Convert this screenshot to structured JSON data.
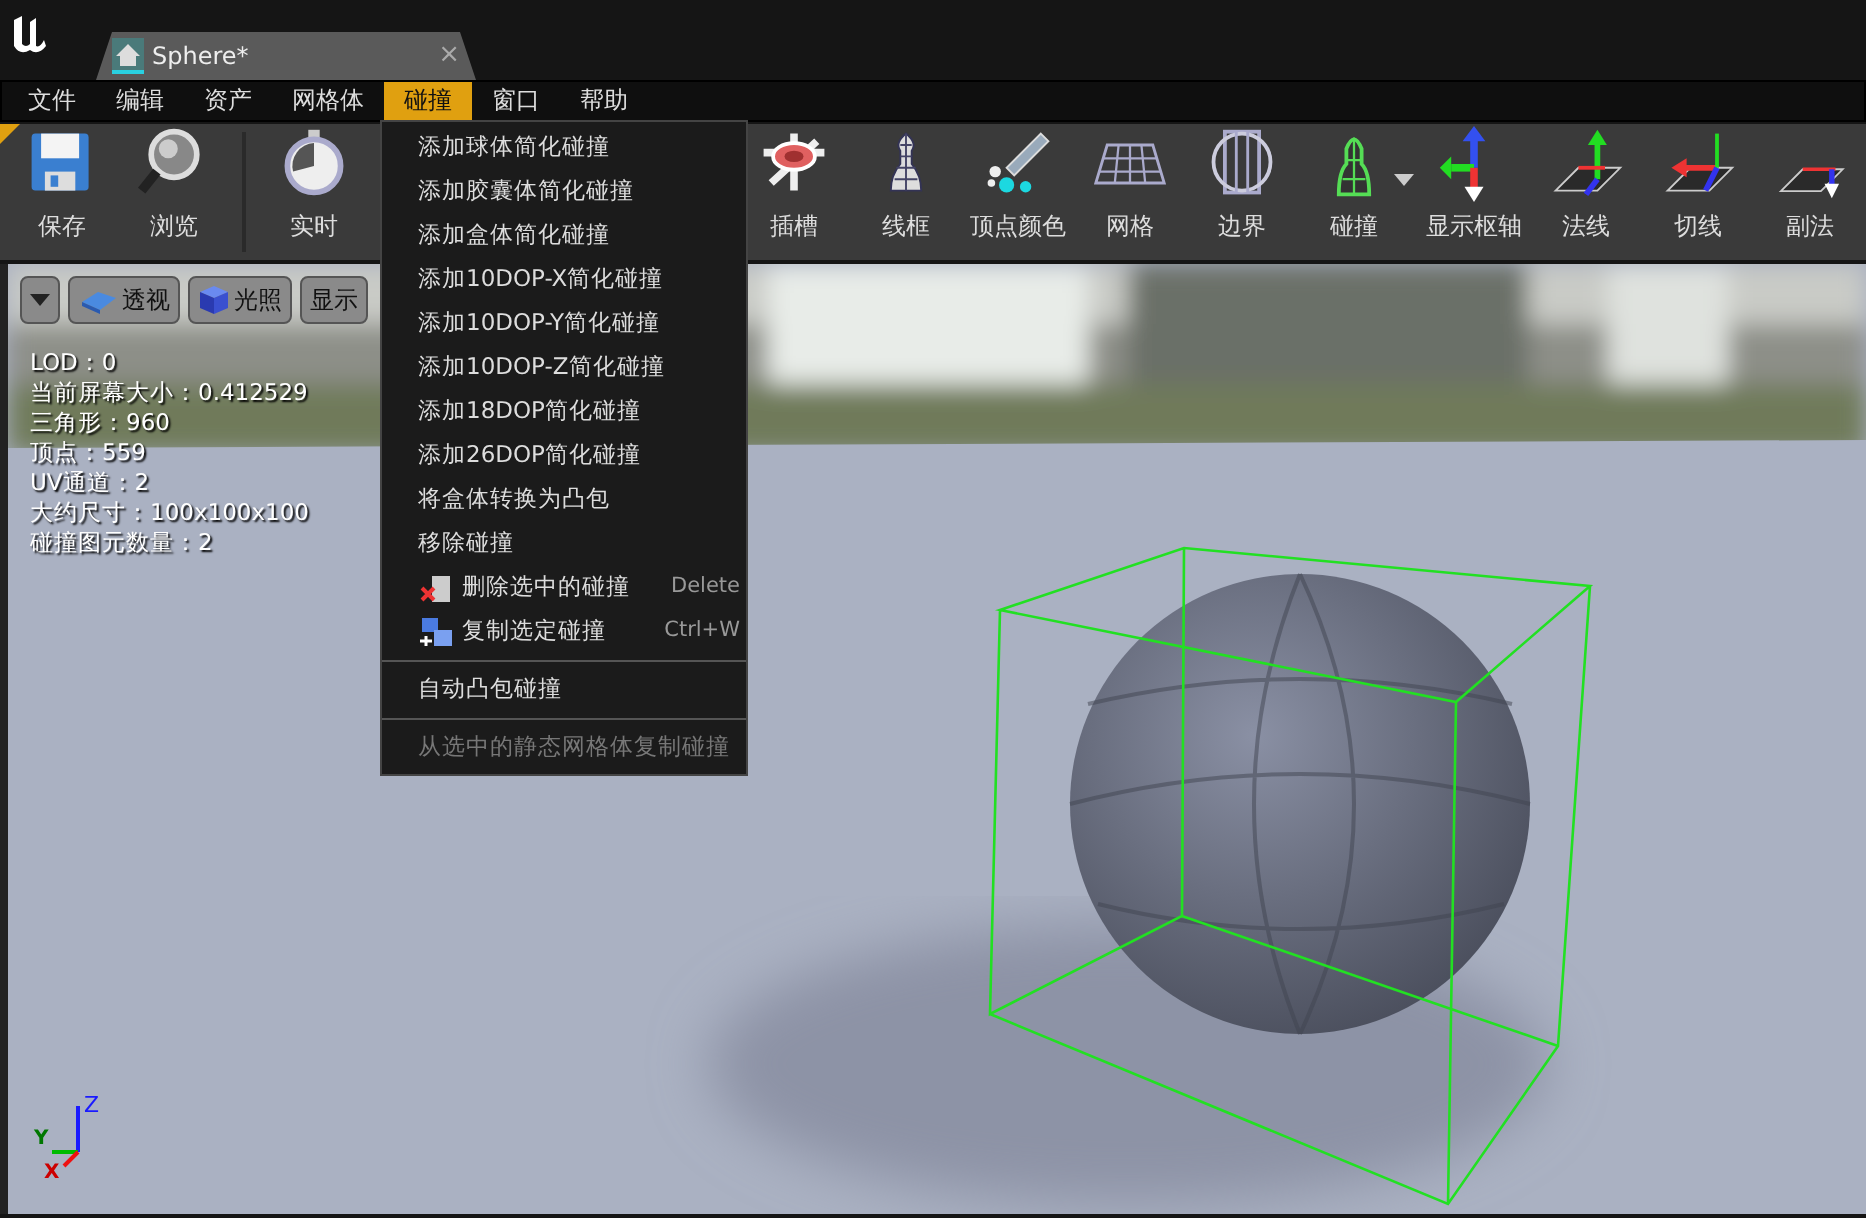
{
  "window": {
    "tab_title": "Sphere*",
    "tab_close": "×"
  },
  "menu_bar": [
    {
      "label": "文件",
      "selected": false
    },
    {
      "label": "编辑",
      "selected": false
    },
    {
      "label": "资产",
      "selected": false
    },
    {
      "label": "网格体",
      "selected": false
    },
    {
      "label": "碰撞",
      "selected": true
    },
    {
      "label": "窗口",
      "selected": false
    },
    {
      "label": "帮助",
      "selected": false
    }
  ],
  "toolbar": [
    {
      "label": "保存",
      "kind": "save"
    },
    {
      "label": "浏览",
      "kind": "browse"
    },
    {
      "label": "实时",
      "kind": "realtime"
    },
    {
      "label": "插槽",
      "kind": "sockets"
    },
    {
      "label": "线框",
      "kind": "wireframe"
    },
    {
      "label": "顶点颜色",
      "kind": "vertexcolor"
    },
    {
      "label": "网格",
      "kind": "grid"
    },
    {
      "label": "边界",
      "kind": "bounds"
    },
    {
      "label": "碰撞",
      "kind": "collision"
    },
    {
      "label": "显示枢轴",
      "kind": "pivot"
    },
    {
      "label": "法线",
      "kind": "normals"
    },
    {
      "label": "切线",
      "kind": "tangents"
    },
    {
      "label": "副法",
      "kind": "binormals"
    }
  ],
  "collision_menu": [
    {
      "kind": "item",
      "label": "添加球体简化碰撞",
      "disabled": false
    },
    {
      "kind": "item",
      "label": "添加胶囊体简化碰撞",
      "disabled": false
    },
    {
      "kind": "item",
      "label": "添加盒体简化碰撞",
      "disabled": false
    },
    {
      "kind": "item",
      "label": "添加10DOP-X简化碰撞",
      "disabled": false
    },
    {
      "kind": "item",
      "label": "添加10DOP-Y简化碰撞",
      "disabled": false
    },
    {
      "kind": "item",
      "label": "添加10DOP-Z简化碰撞",
      "disabled": false
    },
    {
      "kind": "item",
      "label": "添加18DOP简化碰撞",
      "disabled": false
    },
    {
      "kind": "item",
      "label": "添加26DOP简化碰撞",
      "disabled": false
    },
    {
      "kind": "item",
      "label": "将盒体转换为凸包",
      "disabled": false
    },
    {
      "kind": "item",
      "label": "移除碰撞",
      "disabled": false
    },
    {
      "kind": "delete",
      "label": "删除选中的碰撞",
      "shortcut": "Delete",
      "disabled": false
    },
    {
      "kind": "copy",
      "label": "复制选定碰撞",
      "shortcut": "Ctrl+W",
      "disabled": false
    },
    {
      "kind": "separator"
    },
    {
      "kind": "item",
      "label": "自动凸包碰撞",
      "disabled": false
    },
    {
      "kind": "separator"
    },
    {
      "kind": "item",
      "label": "从选中的静态网格体复制碰撞",
      "disabled": true
    }
  ],
  "viewport": {
    "buttons": [
      {
        "kind": "dropdown"
      },
      {
        "kind": "perspective",
        "label": "透视"
      },
      {
        "kind": "lit",
        "label": "光照"
      },
      {
        "kind": "plain",
        "label": "显示"
      }
    ],
    "stats": [
      "LOD：0",
      "当前屏幕大小：0.412529",
      "三角形：960",
      "顶点：559",
      "UV通道：2",
      "大约尺寸：100x100x100",
      "碰撞图元数量：2"
    ],
    "axis_labels": [
      "Z",
      "Y",
      "X"
    ]
  }
}
